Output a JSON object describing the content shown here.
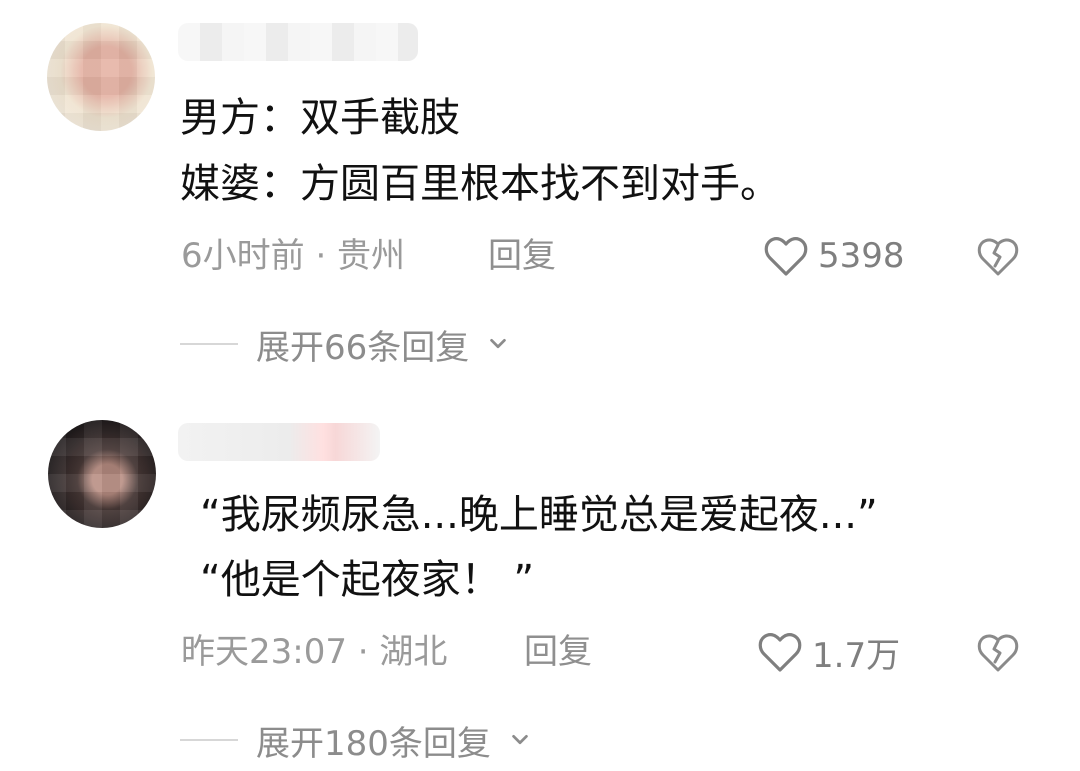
{
  "comments": [
    {
      "lines": [
        "男方：双手截肢",
        "媒婆：方圆百里根本找不到对手。"
      ],
      "meta": "6小时前 · 贵州",
      "reply": "回复",
      "likes": "5398",
      "expand": "展开66条回复"
    },
    {
      "lines": [
        "“我尿频尿急...晚上睡觉总是爱起夜...”",
        "“他是个起夜家！ ”"
      ],
      "meta": "昨天23:07 · 湖北",
      "reply": "回复",
      "likes": "1.7万",
      "expand": "展开180条回复"
    }
  ],
  "icons": {
    "like": "heart-outline-icon",
    "dislike": "broken-heart-icon",
    "expand": "chevron-down-icon"
  },
  "colors": {
    "text_primary": "#111111",
    "text_secondary": "#9a9a9a",
    "icon": "#7f7f7f"
  }
}
